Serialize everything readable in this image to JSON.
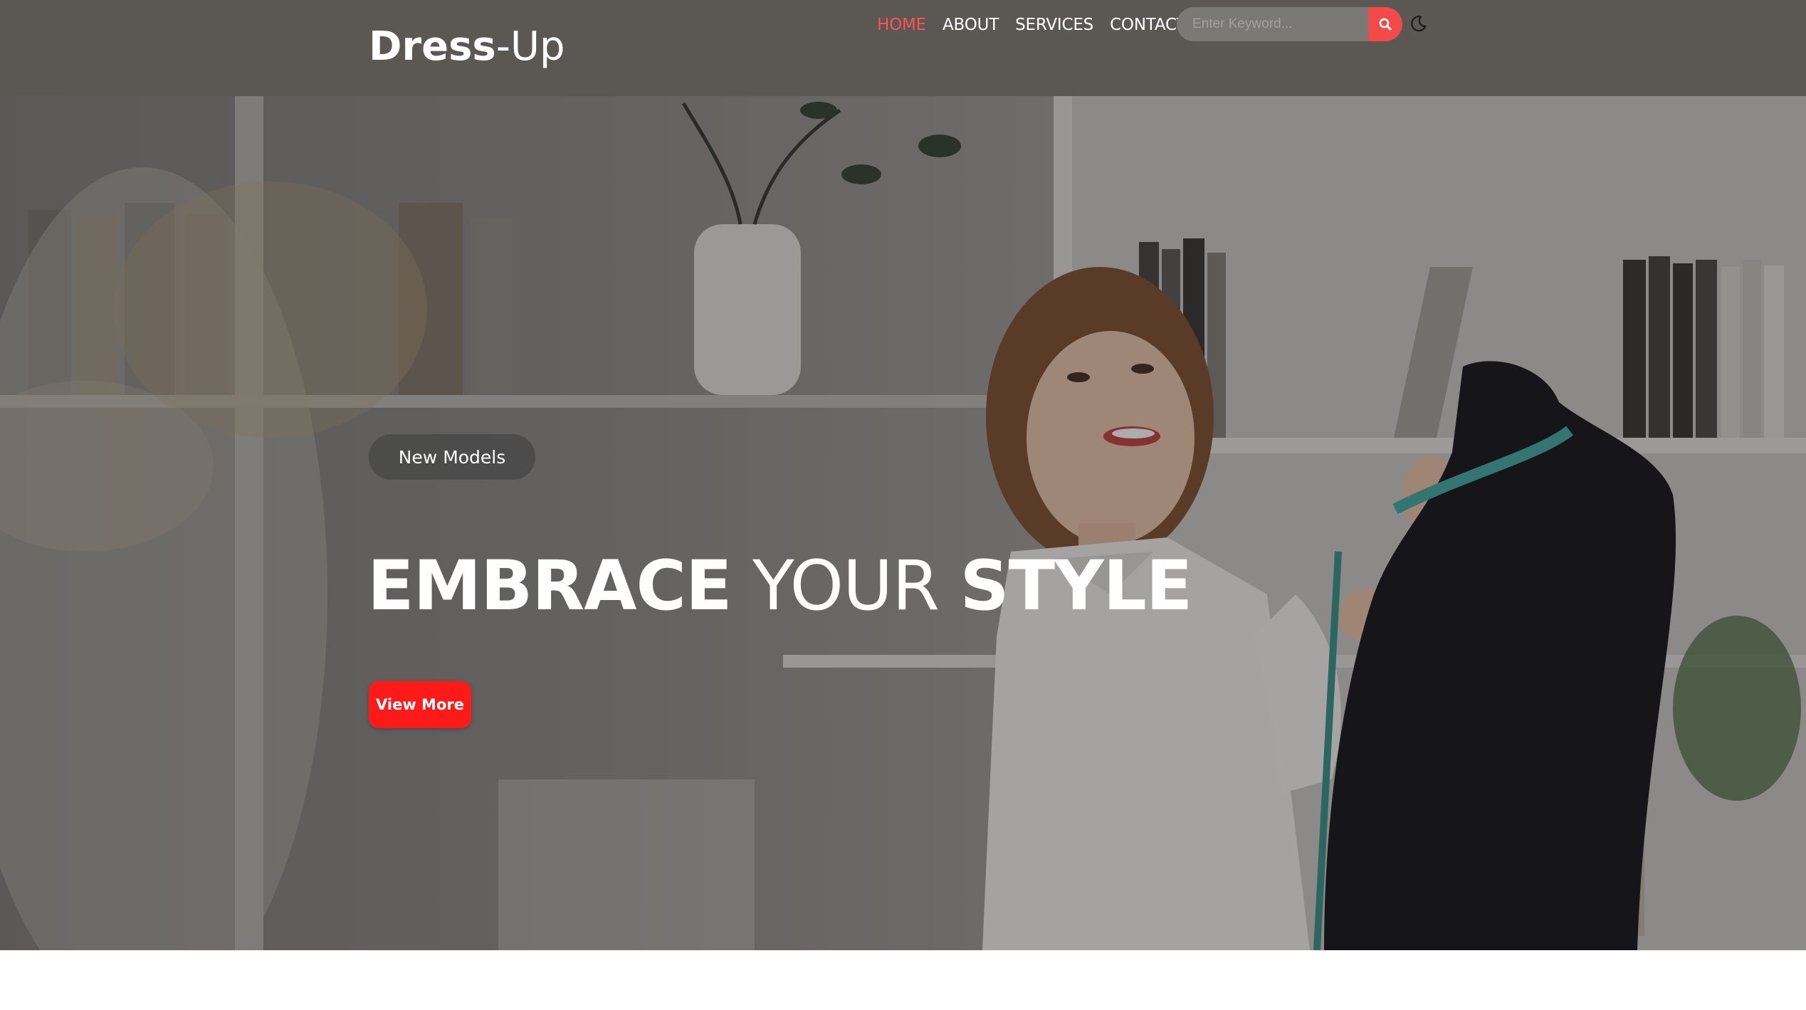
{
  "brand": {
    "name_bold": "Dress",
    "name_light": "-Up"
  },
  "nav": [
    {
      "label": "HOME",
      "active": true
    },
    {
      "label": "ABOUT",
      "active": false
    },
    {
      "label": "SERVICES",
      "active": false
    },
    {
      "label": "CONTACT",
      "active": false
    }
  ],
  "search": {
    "placeholder": "Enter Keyword...",
    "value": "",
    "button_icon": "search-icon"
  },
  "theme_toggle": {
    "icon": "moon-icon"
  },
  "hero": {
    "badge": "New Models",
    "headline_1": "EMBRACE",
    "headline_2": " YOUR ",
    "headline_3": "STYLE",
    "cta_label": "View More"
  },
  "floating_button": {
    "icon": "flag-icon",
    "color": "#2de8ee"
  },
  "colors": {
    "accent": "#f24949",
    "cta": "#ff1a1a",
    "header_bg": "#5b5854"
  }
}
